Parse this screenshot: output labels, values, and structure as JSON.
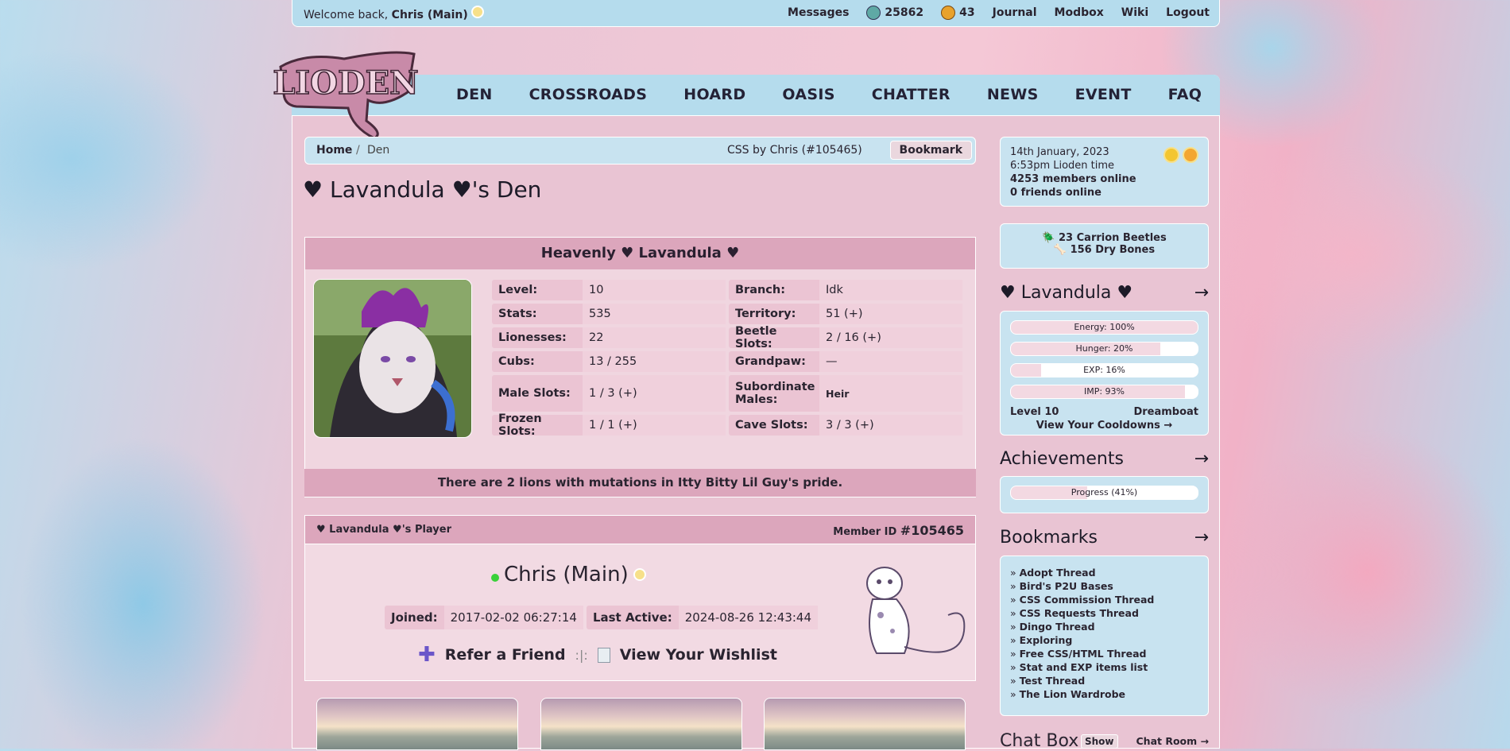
{
  "topbar": {
    "welcome_prefix": "Welcome back, ",
    "username": "Chris (Main)",
    "messages": "Messages",
    "beetles": "25862",
    "gold": "43",
    "journal": "Journal",
    "modbox": "Modbox",
    "wiki": "Wiki",
    "logout": "Logout"
  },
  "nav": [
    "DEN",
    "CROSSROADS",
    "HOARD",
    "OASIS",
    "CHATTER",
    "NEWS",
    "EVENT",
    "FAQ"
  ],
  "logo_text": "LIODEN",
  "breadcrumb": {
    "home": "Home",
    "sep": "/",
    "current": "Den",
    "css_credit": "CSS by Chris (#105465)",
    "bookmark": "Bookmark"
  },
  "page_title": "♥ Lavandula ♥'s Den",
  "lion_panel": {
    "title": "Heavenly ♥ Lavandula ♥",
    "stats": [
      [
        {
          "k": "Level:",
          "v": "10"
        },
        {
          "k": "Branch:",
          "v": "Idk"
        }
      ],
      [
        {
          "k": "Stats:",
          "v": "535"
        },
        {
          "k": "Territory:",
          "v": "51 (+)"
        }
      ],
      [
        {
          "k": "Lionesses:",
          "v": "22"
        },
        {
          "k": "Beetle Slots:",
          "v": "2 / 16 (+)"
        }
      ],
      [
        {
          "k": "Cubs:",
          "v": "13 / 255"
        },
        {
          "k": "Grandpaw:",
          "v": "—"
        }
      ],
      [
        {
          "k": "Male Slots:",
          "v": "1 / 3 (+)"
        },
        {
          "k": "Subordinate Males:",
          "v": "Heir"
        }
      ],
      [
        {
          "k": "Frozen Slots:",
          "v": "1 / 1 (+)"
        },
        {
          "k": "Cave Slots:",
          "v": "3 / 3 (+)"
        }
      ]
    ],
    "mutation_note": "There are 2 lions with mutations in Itty Bitty Lil Guy's pride."
  },
  "player": {
    "header": "♥ Lavandula ♥'s Player",
    "member_label": "Member ID ",
    "member_id": "#105465",
    "name": "Chris (Main)",
    "joined_label": "Joined:",
    "joined": "2017-02-02 06:27:14",
    "active_label": "Last Active:",
    "active": "2024-08-26 12:43:44",
    "refer": "Refer a Friend",
    "divider": ":|:",
    "wishlist": "View Your Wishlist"
  },
  "sidebar": {
    "date": "14th January, 2023",
    "time": "6:53pm Lioden time",
    "members_online": "4253 members online",
    "friends_online": "0 friends online",
    "carrion": "23 Carrion Beetles",
    "dry_bones": "156 Dry Bones",
    "lion_title": "♥ Lavandula ♥",
    "arrow": "→",
    "bars": [
      {
        "label": "Energy: 100%",
        "value": 100
      },
      {
        "label": "Hunger: 20%",
        "value": 80
      },
      {
        "label": "EXP: 16%",
        "value": 16
      },
      {
        "label": "IMP: 93%",
        "value": 93
      }
    ],
    "level": "Level 10",
    "class": "Dreamboat",
    "cooldowns": "View Your Cooldowns →",
    "achievements_title": "Achievements",
    "progress": {
      "label": "Progress (41%)",
      "value": 41
    },
    "bookmarks_title": "Bookmarks",
    "bookmarks": [
      "Adopt Thread",
      "Bird's P2U Bases",
      "CSS Commission Thread",
      "CSS Requests Thread",
      "Dingo Thread",
      "Exploring",
      "Free CSS/HTML Thread",
      "Stat and EXP items list",
      "Test Thread",
      "The Lion Wardrobe"
    ],
    "chat_title": "Chat Box",
    "chat_show": "Show",
    "chat_room": "Chat Room →"
  },
  "colors": {
    "accent_blue": "#b5dced",
    "accent_pink": "#dca6bc",
    "online": "#3ad13a"
  }
}
